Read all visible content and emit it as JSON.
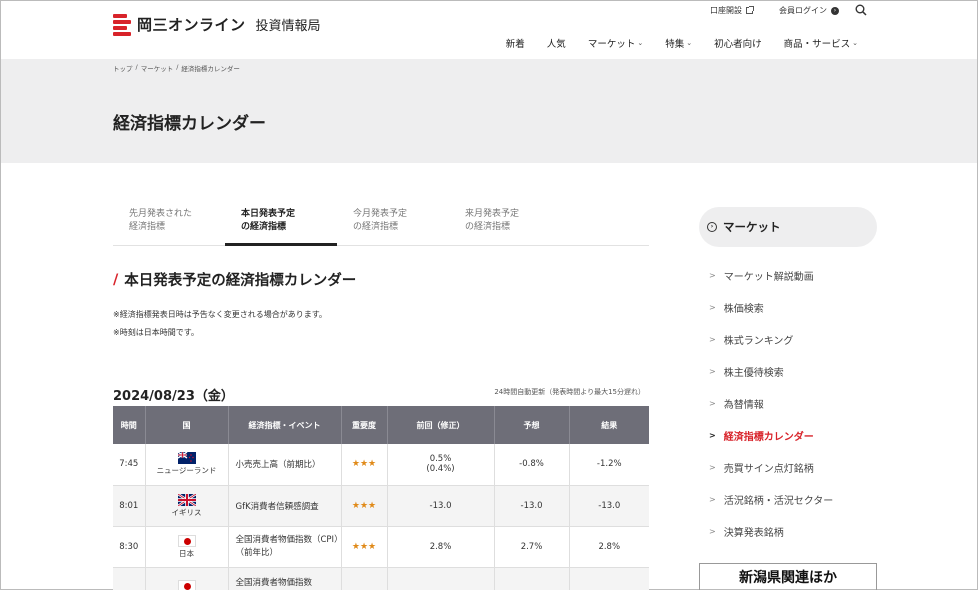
{
  "header": {
    "logo_text": "岡三オンライン",
    "logo_sub": "投資情報局",
    "util": {
      "account": "口座開設",
      "login": "会員ログイン"
    },
    "nav": [
      {
        "label": "新着",
        "dropdown": false
      },
      {
        "label": "人気",
        "dropdown": false
      },
      {
        "label": "マーケット",
        "dropdown": true
      },
      {
        "label": "特集",
        "dropdown": true
      },
      {
        "label": "初心者向け",
        "dropdown": false
      },
      {
        "label": "商品・サービス",
        "dropdown": true
      }
    ]
  },
  "breadcrumb": [
    "トップ",
    "/",
    "マーケット",
    "/",
    "経済指標カレンダー"
  ],
  "page_title": "経済指標カレンダー",
  "tabs": [
    {
      "line1": "先月発表された",
      "line2": "経済指標",
      "active": false
    },
    {
      "line1": "本日発表予定",
      "line2": "の経済指標",
      "active": true
    },
    {
      "line1": "今月発表予定",
      "line2": "の経済指標",
      "active": false
    },
    {
      "line1": "来月発表予定",
      "line2": "の経済指標",
      "active": false
    }
  ],
  "section": {
    "slash": "/",
    "title": "本日発表予定の経済指標カレンダー",
    "notes": [
      "※経済指標発表日時は予告なく変更される場合があります。",
      "※時刻は日本時間です。"
    ]
  },
  "date": "2024/08/23（金）",
  "update_note": "24時間自動更新（発表時間より最大15分遅れ）",
  "table": {
    "headers": [
      "時間",
      "国",
      "経済指標・イベント",
      "重要度",
      "前回（修正）",
      "予想",
      "結果"
    ],
    "rows": [
      {
        "time": "7:45",
        "flag": "nz",
        "country": "ニュージーランド",
        "event": "小売売上高（前期比）",
        "stars": "★★★",
        "prev": "0.5%",
        "prev_rev": "(0.4%)",
        "forecast": "-0.8%",
        "result": "-1.2%"
      },
      {
        "time": "8:01",
        "flag": "uk",
        "country": "イギリス",
        "event": "GfK消費者信頼感調査",
        "stars": "★★★",
        "prev": "-13.0",
        "prev_rev": "",
        "forecast": "-13.0",
        "result": "-13.0"
      },
      {
        "time": "8:30",
        "flag": "jp",
        "country": "日本",
        "event": "全国消費者物価指数（CPI）（前年比）",
        "stars": "★★★",
        "prev": "2.8%",
        "prev_rev": "",
        "forecast": "2.7%",
        "result": "2.8%"
      },
      {
        "time": "",
        "flag": "jp",
        "country": "",
        "event": "全国消費者物価指数",
        "stars": "",
        "prev": "",
        "prev_rev": "",
        "forecast": "",
        "result": ""
      }
    ]
  },
  "sidebar": {
    "heading": "マーケット",
    "items": [
      {
        "label": "マーケット解説動画",
        "active": false
      },
      {
        "label": "株価検索",
        "active": false
      },
      {
        "label": "株式ランキング",
        "active": false
      },
      {
        "label": "株主優待検索",
        "active": false
      },
      {
        "label": "為替情報",
        "active": false
      },
      {
        "label": "経済指標カレンダー",
        "active": true
      },
      {
        "label": "売買サイン点灯銘柄",
        "active": false
      },
      {
        "label": "活況銘柄・活況セクター",
        "active": false
      },
      {
        "label": "決算発表銘柄",
        "active": false
      }
    ],
    "banner": "新潟県関連ほか"
  },
  "colors": {
    "accent": "#d8232a",
    "table_header": "#6e6e78",
    "star": "#e08a19"
  }
}
